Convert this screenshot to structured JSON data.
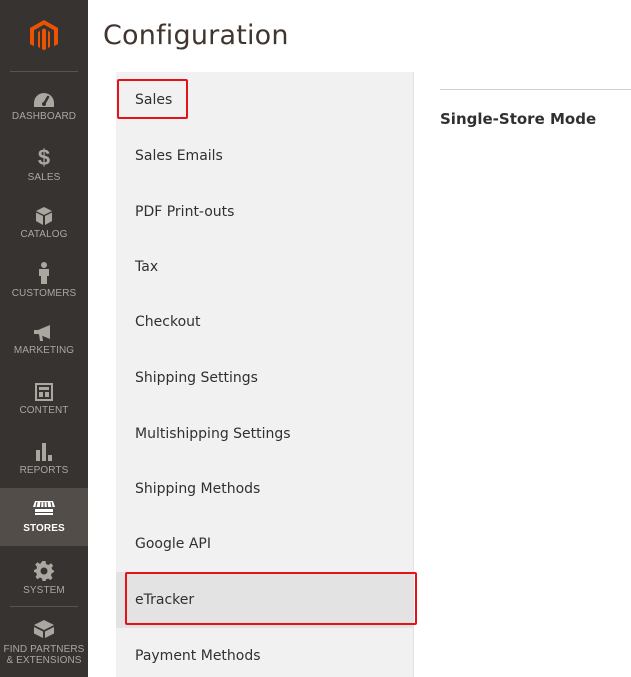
{
  "page": {
    "title": "Configuration"
  },
  "nav": {
    "items": [
      {
        "label": "Dashboard",
        "icon": "dashboard-icon"
      },
      {
        "label": "$",
        "sublabel": "Sales",
        "icon": "dollar-icon"
      },
      {
        "label": "Catalog",
        "icon": "catalog-box-icon"
      },
      {
        "label": "Customers",
        "icon": "customer-person-icon"
      },
      {
        "label": "Marketing",
        "icon": "megaphone-icon"
      },
      {
        "label": "Content",
        "icon": "content-layout-icon"
      },
      {
        "label": "Reports",
        "icon": "bar-chart-icon"
      },
      {
        "label": "Stores",
        "icon": "storefront-icon"
      },
      {
        "label": "System",
        "icon": "gear-icon"
      },
      {
        "label": "Find Partners",
        "label2": "& Extensions",
        "icon": "cube-stack-icon"
      }
    ],
    "active": "Stores"
  },
  "tabs": {
    "items": [
      {
        "label": "Sales"
      },
      {
        "label": "Sales Emails"
      },
      {
        "label": "PDF Print-outs"
      },
      {
        "label": "Tax"
      },
      {
        "label": "Checkout"
      },
      {
        "label": "Shipping Settings"
      },
      {
        "label": "Multishipping Settings"
      },
      {
        "label": "Shipping Methods"
      },
      {
        "label": "Google API"
      },
      {
        "label": "eTracker"
      },
      {
        "label": "Payment Methods"
      }
    ],
    "selected": "eTracker"
  },
  "content": {
    "section_title": "Single-Store Mode"
  },
  "colors": {
    "nav_bg": "#373330",
    "logo_orange": "#eb5202",
    "highlight_red": "#e4131b",
    "tabs_bg": "#f1f1f1"
  }
}
